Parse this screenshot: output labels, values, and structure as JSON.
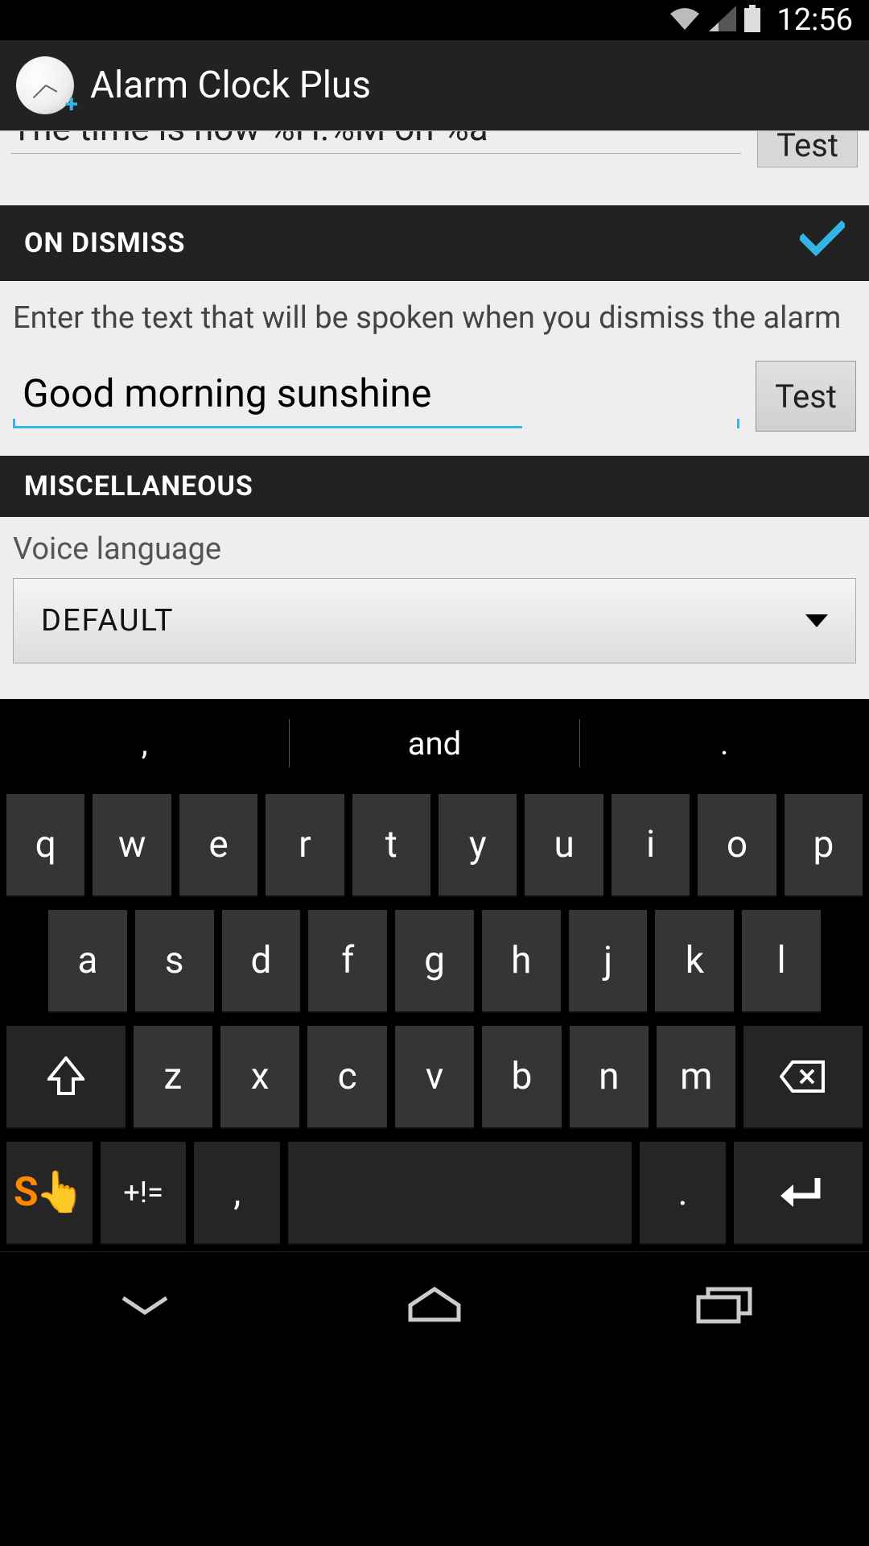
{
  "status": {
    "time": "12:56"
  },
  "app": {
    "title": "Alarm Clock Plus"
  },
  "partial": {
    "text": "The time is now %H:%M on %a",
    "test": "Test"
  },
  "dismiss": {
    "header": "ON DISMISS",
    "desc": "Enter the text that will be spoken when you dismiss the alarm",
    "value": "Good morning sunshine",
    "test": "Test"
  },
  "misc": {
    "header": "MISCELLANEOUS",
    "voice_label": "Voice language",
    "voice_value": "DEFAULT"
  },
  "keyboard": {
    "suggestions": [
      ",",
      "and",
      "."
    ],
    "row1": [
      "q",
      "w",
      "e",
      "r",
      "t",
      "y",
      "u",
      "i",
      "o",
      "p"
    ],
    "row2": [
      "a",
      "s",
      "d",
      "f",
      "g",
      "h",
      "j",
      "k",
      "l"
    ],
    "row3": [
      "z",
      "x",
      "c",
      "v",
      "b",
      "n",
      "m"
    ],
    "symkey": "+!=",
    "comma": ",",
    "period": "."
  }
}
